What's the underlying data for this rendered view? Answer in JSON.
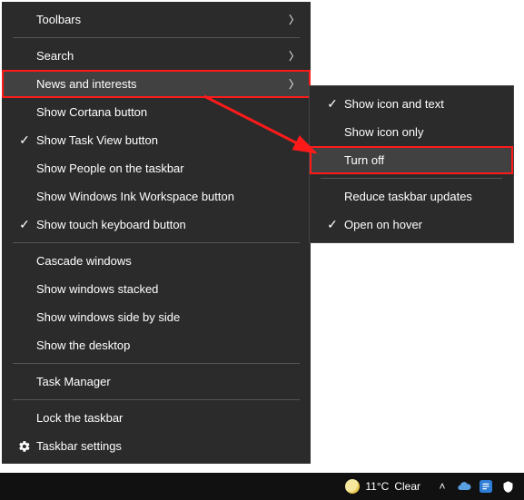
{
  "main_menu": {
    "items": [
      {
        "label": "Toolbars",
        "has_submenu": true,
        "checked": false,
        "separator_after": true
      },
      {
        "label": "Search",
        "has_submenu": true,
        "checked": false
      },
      {
        "label": "News and interests",
        "has_submenu": true,
        "checked": false,
        "highlighted": true,
        "hover": true
      },
      {
        "label": "Show Cortana button",
        "checked": false
      },
      {
        "label": "Show Task View button",
        "checked": true
      },
      {
        "label": "Show People on the taskbar",
        "checked": false
      },
      {
        "label": "Show Windows Ink Workspace button",
        "checked": false
      },
      {
        "label": "Show touch keyboard button",
        "checked": true,
        "separator_after": true
      },
      {
        "label": "Cascade windows",
        "checked": false
      },
      {
        "label": "Show windows stacked",
        "checked": false
      },
      {
        "label": "Show windows side by side",
        "checked": false
      },
      {
        "label": "Show the desktop",
        "checked": false,
        "separator_after": true
      },
      {
        "label": "Task Manager",
        "checked": false,
        "separator_after": true
      },
      {
        "label": "Lock the taskbar",
        "checked": false
      },
      {
        "label": "Taskbar settings",
        "checked": false,
        "icon": "gear"
      }
    ]
  },
  "submenu": {
    "items": [
      {
        "label": "Show icon and text",
        "checked": true
      },
      {
        "label": "Show icon only",
        "checked": false
      },
      {
        "label": "Turn off",
        "checked": false,
        "highlighted": true,
        "hover": true,
        "separator_after": true
      },
      {
        "label": "Reduce taskbar updates",
        "checked": false
      },
      {
        "label": "Open on hover",
        "checked": true
      }
    ]
  },
  "taskbar": {
    "weather_temp": "11°C",
    "weather_cond": "Clear"
  },
  "annotations": {
    "highlight_color": "#ff1a1a"
  }
}
